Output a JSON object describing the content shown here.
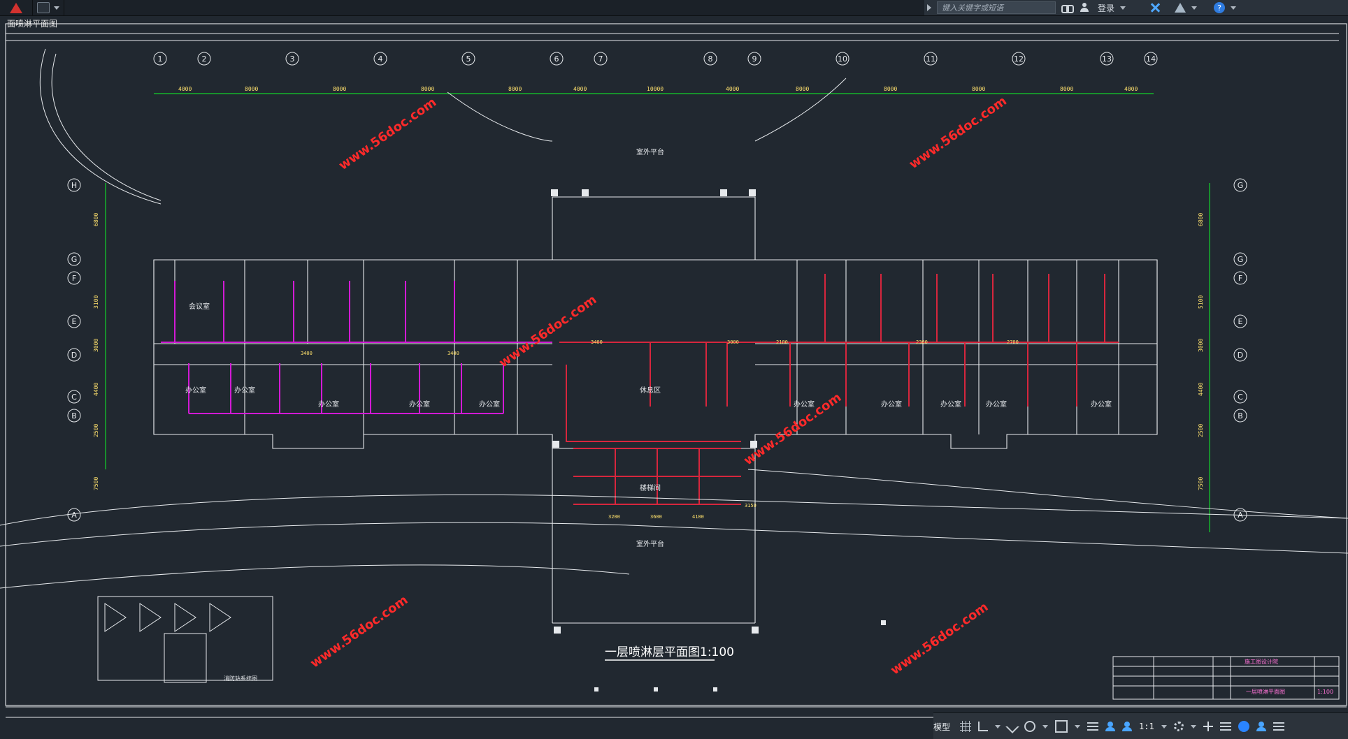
{
  "toolbar": {
    "drawing_tab": "面喷淋平面图",
    "search_placeholder": "键入关键字或短语",
    "login_label": "登录"
  },
  "status": {
    "model_label": "模型",
    "scale_label": "1:1"
  },
  "drawing": {
    "title": "一层喷淋层平面图1:100",
    "watermark": "www.56doc.com",
    "grid_labels_top": [
      "1",
      "2",
      "3",
      "4",
      "5",
      "6",
      "7",
      "8",
      "9",
      "10",
      "11",
      "12",
      "13",
      "14"
    ],
    "grid_labels_left": [
      "H",
      "G",
      "F",
      "E",
      "D",
      "C",
      "B",
      "A"
    ],
    "grid_labels_right": [
      "G",
      "G",
      "F",
      "E",
      "D",
      "C",
      "B",
      "A"
    ],
    "dimensions_top": [
      "4000",
      "8000",
      "8000",
      "8000",
      "8000",
      "4000",
      "10000",
      "4000",
      "8000",
      "8000",
      "8000",
      "8000",
      "4000"
    ],
    "dimensions_left": [
      "6800",
      "3100",
      "3000",
      "4400",
      "2500",
      "7500"
    ],
    "dimensions_right": [
      "6800",
      "5100",
      "3000",
      "4400",
      "2500",
      "7500"
    ],
    "room_labels": [
      "会议室",
      "办公室",
      "办公室",
      "办公室",
      "办公室",
      "办公室",
      "办公室",
      "办公室",
      "办公室",
      "办公室",
      "办公室",
      "休息区",
      "楼梯间",
      "室外平台",
      "室外平台"
    ],
    "pipe_labels": [
      "3400",
      "3400",
      "3400",
      "3000",
      "2100",
      "2300",
      "2700",
      "3200",
      "3600",
      "4100",
      "3150"
    ],
    "legend_title": "消防站系统图",
    "table_title": "施工图设计院",
    "table_subtitle": "一层喷淋平面图",
    "table_scale": "1:100"
  },
  "colors": {
    "background": "#212830",
    "pipe_red": "#d7263d",
    "pipe_magenta": "#d21ad5",
    "grid_green": "#13d12b",
    "line_white": "#e6e9ec",
    "watermark_red": "#ff2a2a",
    "accent_blue": "#2f7ce0"
  }
}
